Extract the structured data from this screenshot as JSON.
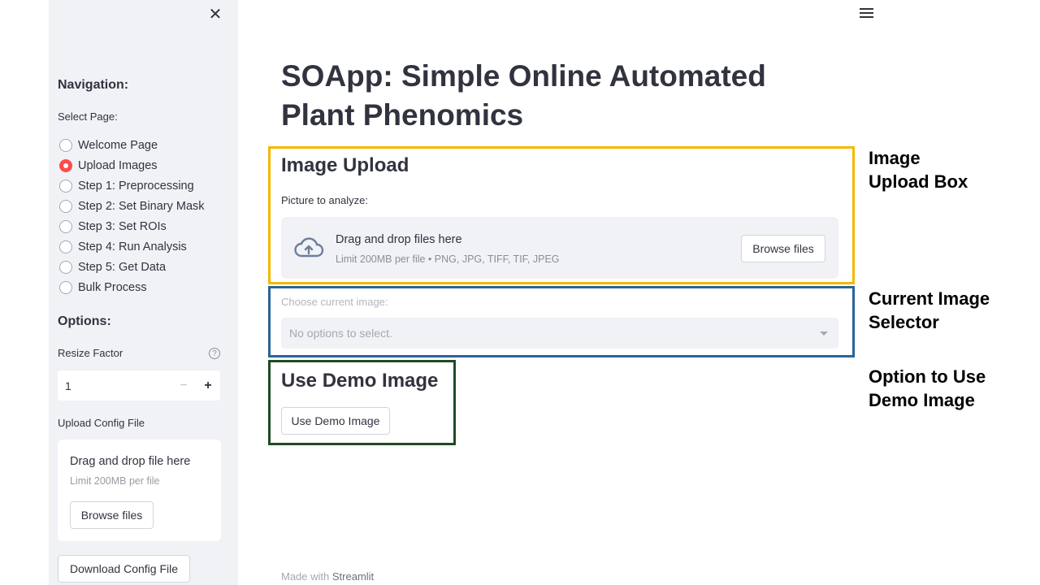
{
  "sidebar": {
    "close_icon": "close-icon",
    "navigation_heading": "Navigation:",
    "select_page_label": "Select Page:",
    "pages": [
      {
        "label": "Welcome Page",
        "selected": false
      },
      {
        "label": "Upload Images",
        "selected": true
      },
      {
        "label": "Step 1: Preprocessing",
        "selected": false
      },
      {
        "label": "Step 2: Set Binary Mask",
        "selected": false
      },
      {
        "label": "Step 3: Set ROIs",
        "selected": false
      },
      {
        "label": "Step 4: Run Analysis",
        "selected": false
      },
      {
        "label": "Step 5: Get Data",
        "selected": false
      },
      {
        "label": "Bulk Process",
        "selected": false
      }
    ],
    "options_heading": "Options:",
    "resize_factor_label": "Resize Factor",
    "resize_factor_value": "1",
    "minus": "−",
    "plus": "+",
    "upload_config_label": "Upload Config File",
    "config_drag_text": "Drag and drop file here",
    "config_limit_text": "Limit 200MB per file",
    "config_browse_label": "Browse files",
    "download_config_label": "Download Config File"
  },
  "main": {
    "title": "SOApp: Simple Online Automated Plant Phenomics",
    "image_upload": {
      "heading": "Image Upload",
      "picture_label": "Picture to analyze:",
      "drag_text": "Drag and drop files here",
      "limit_text": "Limit 200MB per file • PNG, JPG, TIFF, TIF, JPEG",
      "browse_label": "Browse files"
    },
    "current_image": {
      "label": "Choose current image:",
      "placeholder": "No options to select."
    },
    "demo": {
      "heading": "Use Demo Image",
      "button_label": "Use Demo Image"
    },
    "footer_prefix": "Made with ",
    "footer_brand": "Streamlit"
  },
  "annotations": {
    "upload_box": {
      "line1": "Image",
      "line2": "Upload Box",
      "color": "#f5b800"
    },
    "selector_box": {
      "line1": "Current Image",
      "line2": "Selector",
      "color": "#2a6496"
    },
    "demo_box": {
      "line1": "Option to Use",
      "line2": "Demo Image",
      "color": "#1e4b22"
    }
  },
  "colors": {
    "accent": "#ff4b4b",
    "sidebar_bg": "#f0f2f6",
    "text": "#31333f"
  }
}
